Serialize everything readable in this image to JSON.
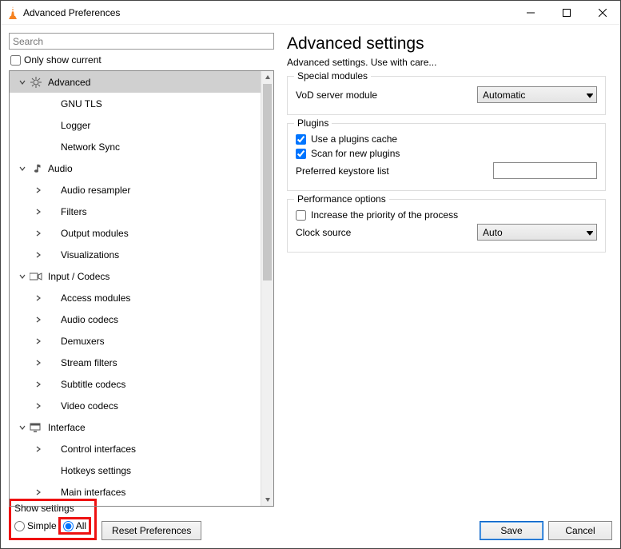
{
  "window": {
    "title": "Advanced Preferences"
  },
  "sidebar": {
    "search_placeholder": "Search",
    "only_show_current_label": "Only show current",
    "only_show_current_checked": false,
    "items": [
      {
        "id": "advanced",
        "depth": 0,
        "chevron": "down",
        "icon": "gear",
        "label": "Advanced",
        "selected": true
      },
      {
        "id": "gnu-tls",
        "depth": 1,
        "chevron": "none",
        "icon": "none",
        "label": "GNU TLS"
      },
      {
        "id": "logger",
        "depth": 1,
        "chevron": "none",
        "icon": "none",
        "label": "Logger"
      },
      {
        "id": "network-sync",
        "depth": 1,
        "chevron": "none",
        "icon": "none",
        "label": "Network Sync"
      },
      {
        "id": "audio",
        "depth": 0,
        "chevron": "down",
        "icon": "audio",
        "label": "Audio"
      },
      {
        "id": "audio-resampler",
        "depth": 1,
        "chevron": "right",
        "icon": "none",
        "label": "Audio resampler"
      },
      {
        "id": "filters",
        "depth": 1,
        "chevron": "right",
        "icon": "none",
        "label": "Filters"
      },
      {
        "id": "output-modules",
        "depth": 1,
        "chevron": "right",
        "icon": "none",
        "label": "Output modules"
      },
      {
        "id": "visualizations",
        "depth": 1,
        "chevron": "right",
        "icon": "none",
        "label": "Visualizations"
      },
      {
        "id": "input-codecs",
        "depth": 0,
        "chevron": "down",
        "icon": "codec",
        "label": "Input / Codecs"
      },
      {
        "id": "access-modules",
        "depth": 1,
        "chevron": "right",
        "icon": "none",
        "label": "Access modules"
      },
      {
        "id": "audio-codecs",
        "depth": 1,
        "chevron": "right",
        "icon": "none",
        "label": "Audio codecs"
      },
      {
        "id": "demuxers",
        "depth": 1,
        "chevron": "right",
        "icon": "none",
        "label": "Demuxers"
      },
      {
        "id": "stream-filters",
        "depth": 1,
        "chevron": "right",
        "icon": "none",
        "label": "Stream filters"
      },
      {
        "id": "subtitle-codecs",
        "depth": 1,
        "chevron": "right",
        "icon": "none",
        "label": "Subtitle codecs"
      },
      {
        "id": "video-codecs",
        "depth": 1,
        "chevron": "right",
        "icon": "none",
        "label": "Video codecs"
      },
      {
        "id": "interface",
        "depth": 0,
        "chevron": "down",
        "icon": "iface",
        "label": "Interface"
      },
      {
        "id": "control-if",
        "depth": 1,
        "chevron": "right",
        "icon": "none",
        "label": "Control interfaces"
      },
      {
        "id": "hotkeys",
        "depth": 1,
        "chevron": "none",
        "icon": "none",
        "label": "Hotkeys settings"
      },
      {
        "id": "main-if",
        "depth": 1,
        "chevron": "right",
        "icon": "none",
        "label": "Main interfaces"
      }
    ]
  },
  "main": {
    "heading": "Advanced settings",
    "subtitle": "Advanced settings. Use with care...",
    "groups": {
      "special_modules": {
        "legend": "Special modules",
        "vod_label": "VoD server module",
        "vod_value": "Automatic"
      },
      "plugins": {
        "legend": "Plugins",
        "use_cache_label": "Use a plugins cache",
        "use_cache_checked": true,
        "scan_label": "Scan for new plugins",
        "scan_checked": true,
        "keystore_label": "Preferred keystore list",
        "keystore_value": ""
      },
      "performance": {
        "legend": "Performance options",
        "increase_priority_label": "Increase the priority of the process",
        "increase_priority_checked": false,
        "clock_label": "Clock source",
        "clock_value": "Auto"
      }
    }
  },
  "footer": {
    "show_settings_label": "Show settings",
    "radio_simple_label": "Simple",
    "radio_all_label": "All",
    "radio_selected": "all",
    "reset_label": "Reset Preferences",
    "save_label": "Save",
    "cancel_label": "Cancel"
  }
}
